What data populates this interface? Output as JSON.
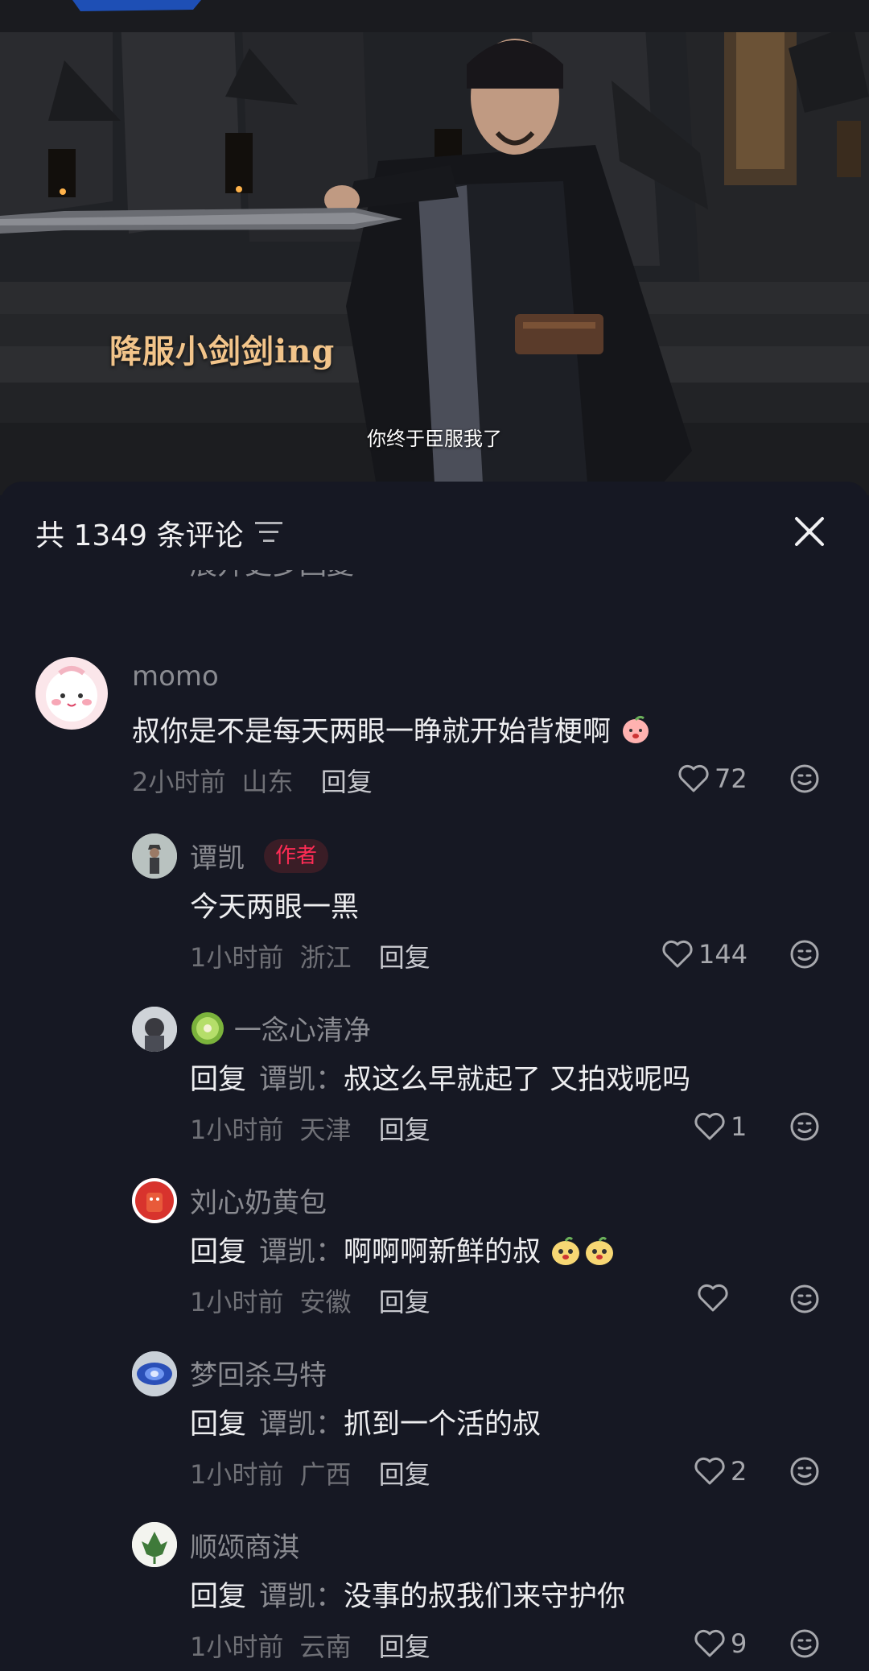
{
  "video": {
    "stylized_caption": "降服小剑剑ing",
    "subtitle": "你终于臣服我了"
  },
  "comments_panel": {
    "count_label": "共 1349 条评论",
    "cut_text": "展开更多回复",
    "comments": [
      {
        "username": "momo",
        "content": "叔你是不是每天两眼一睁就开始背梗啊",
        "time": "2小时前",
        "location": "山东",
        "reply_label": "回复",
        "likes": "72"
      },
      {
        "username": "谭凯",
        "badge": "作者",
        "content": "今天两眼一黑",
        "time": "1小时前",
        "location": "浙江",
        "reply_label": "回复",
        "likes": "144"
      },
      {
        "username": "一念心清净",
        "reply_prefix": "回复",
        "reply_to": "谭凯：",
        "content": "叔这么早就起了 又拍戏呢吗",
        "time": "1小时前",
        "location": "天津",
        "reply_label": "回复",
        "likes": "1"
      },
      {
        "username": "刘心奶黄包",
        "reply_prefix": "回复",
        "reply_to": "谭凯：",
        "content": "啊啊啊新鲜的叔",
        "time": "1小时前",
        "location": "安徽",
        "reply_label": "回复",
        "likes": ""
      },
      {
        "username": "梦回杀马特",
        "reply_prefix": "回复",
        "reply_to": "谭凯：",
        "content": "抓到一个活的叔",
        "time": "1小时前",
        "location": "广西",
        "reply_label": "回复",
        "likes": "2"
      },
      {
        "username": "顺颂商淇",
        "reply_prefix": "回复",
        "reply_to": "谭凯：",
        "content": "没事的叔我们来守护你",
        "time": "1小时前",
        "location": "云南",
        "reply_label": "回复",
        "likes": "9"
      }
    ]
  },
  "icons": {
    "sort": "sort-icon",
    "close": "close-icon",
    "like": "heart-outline-icon",
    "emoji": "smiley-icon"
  },
  "colors": {
    "background": "#161823",
    "author_badge": "#fe2c55",
    "caption_gold": "#f2c48a"
  }
}
